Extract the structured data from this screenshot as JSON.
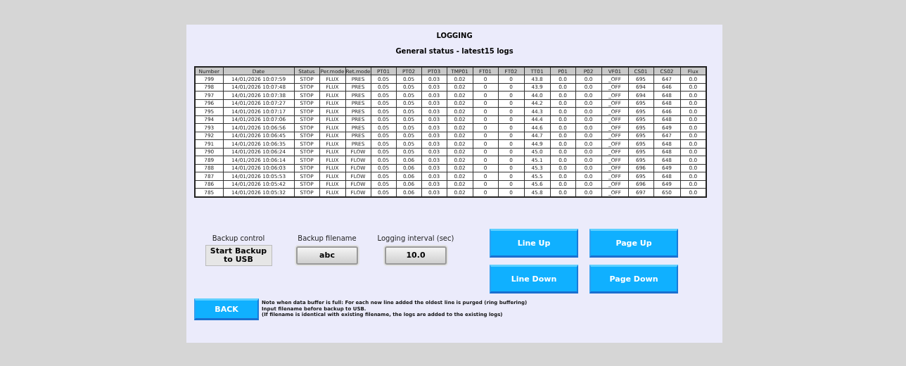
{
  "title": "LOGGING",
  "subtitle": "General status - latest15 logs",
  "table": {
    "columns": [
      "Number",
      "Date",
      "Status",
      "Per.mode",
      "Ret.mode",
      "PT01",
      "PT02",
      "PT03",
      "TMP01",
      "FT01",
      "FT02",
      "TT01",
      "P01",
      "P02",
      "VF01",
      "CS01",
      "CS02",
      "Flux"
    ],
    "rows": [
      [
        "799",
        "14/01/2026 10:07:59",
        "STOP",
        "FLUX",
        "PRES",
        "0.05",
        "0.05",
        "0.03",
        "0.02",
        "0",
        "0",
        "43.8",
        "0.0",
        "0.0",
        "_OFF",
        "695",
        "647",
        "0.0"
      ],
      [
        "798",
        "14/01/2026 10:07:48",
        "STOP",
        "FLUX",
        "PRES",
        "0.05",
        "0.05",
        "0.03",
        "0.02",
        "0",
        "0",
        "43.9",
        "0.0",
        "0.0",
        "_OFF",
        "694",
        "646",
        "0.0"
      ],
      [
        "797",
        "14/01/2026 10:07:38",
        "STOP",
        "FLUX",
        "PRES",
        "0.05",
        "0.05",
        "0.03",
        "0.02",
        "0",
        "0",
        "44.0",
        "0.0",
        "0.0",
        "_OFF",
        "694",
        "648",
        "0.0"
      ],
      [
        "796",
        "14/01/2026 10:07:27",
        "STOP",
        "FLUX",
        "PRES",
        "0.05",
        "0.05",
        "0.03",
        "0.02",
        "0",
        "0",
        "44.2",
        "0.0",
        "0.0",
        "_OFF",
        "695",
        "648",
        "0.0"
      ],
      [
        "795",
        "14/01/2026 10:07:17",
        "STOP",
        "FLUX",
        "PRES",
        "0.05",
        "0.05",
        "0.03",
        "0.02",
        "0",
        "0",
        "44.3",
        "0.0",
        "0.0",
        "_OFF",
        "695",
        "646",
        "0.0"
      ],
      [
        "794",
        "14/01/2026 10:07:06",
        "STOP",
        "FLUX",
        "PRES",
        "0.05",
        "0.05",
        "0.03",
        "0.02",
        "0",
        "0",
        "44.4",
        "0.0",
        "0.0",
        "_OFF",
        "695",
        "648",
        "0.0"
      ],
      [
        "793",
        "14/01/2026 10:06:56",
        "STOP",
        "FLUX",
        "PRES",
        "0.05",
        "0.05",
        "0.03",
        "0.02",
        "0",
        "0",
        "44.6",
        "0.0",
        "0.0",
        "_OFF",
        "695",
        "649",
        "0.0"
      ],
      [
        "792",
        "14/01/2026 10:06:45",
        "STOP",
        "FLUX",
        "PRES",
        "0.05",
        "0.05",
        "0.03",
        "0.02",
        "0",
        "0",
        "44.7",
        "0.0",
        "0.0",
        "_OFF",
        "695",
        "647",
        "0.0"
      ],
      [
        "791",
        "14/01/2026 10:06:35",
        "STOP",
        "FLUX",
        "PRES",
        "0.05",
        "0.05",
        "0.03",
        "0.02",
        "0",
        "0",
        "44.9",
        "0.0",
        "0.0",
        "_OFF",
        "695",
        "648",
        "0.0"
      ],
      [
        "790",
        "14/01/2026 10:06:24",
        "STOP",
        "FLUX",
        "FLOW",
        "0.05",
        "0.05",
        "0.03",
        "0.02",
        "0",
        "0",
        "45.0",
        "0.0",
        "0.0",
        "_OFF",
        "695",
        "648",
        "0.0"
      ],
      [
        "789",
        "14/01/2026 10:06:14",
        "STOP",
        "FLUX",
        "FLOW",
        "0.05",
        "0.06",
        "0.03",
        "0.02",
        "0",
        "0",
        "45.1",
        "0.0",
        "0.0",
        "_OFF",
        "695",
        "648",
        "0.0"
      ],
      [
        "788",
        "14/01/2026 10:06:03",
        "STOP",
        "FLUX",
        "FLOW",
        "0.05",
        "0.06",
        "0.03",
        "0.02",
        "0",
        "0",
        "45.3",
        "0.0",
        "0.0",
        "_OFF",
        "696",
        "649",
        "0.0"
      ],
      [
        "787",
        "14/01/2026 10:05:53",
        "STOP",
        "FLUX",
        "FLOW",
        "0.05",
        "0.06",
        "0.03",
        "0.02",
        "0",
        "0",
        "45.5",
        "0.0",
        "0.0",
        "_OFF",
        "695",
        "648",
        "0.0"
      ],
      [
        "786",
        "14/01/2026 10:05:42",
        "STOP",
        "FLUX",
        "FLOW",
        "0.05",
        "0.06",
        "0.03",
        "0.02",
        "0",
        "0",
        "45.6",
        "0.0",
        "0.0",
        "_OFF",
        "696",
        "649",
        "0.0"
      ],
      [
        "785",
        "14/01/2026 10:05:32",
        "STOP",
        "FLUX",
        "FLOW",
        "0.05",
        "0.06",
        "0.03",
        "0.02",
        "0",
        "0",
        "45.8",
        "0.0",
        "0.0",
        "_OFF",
        "697",
        "650",
        "0.0"
      ]
    ]
  },
  "controls": [
    {
      "label": "Backup control",
      "value": "Start Backup to USB",
      "kind": "button"
    },
    {
      "label": "Backup filename",
      "value": "abc",
      "kind": "field"
    },
    {
      "label": "Logging interval (sec)",
      "value": "10.0",
      "kind": "field"
    }
  ],
  "nav_buttons": [
    "Line Up",
    "Page Up",
    "Line Down",
    "Page Down"
  ],
  "back_button": "BACK",
  "notes": [
    "Note when data buffer is full: For each new line added the oldest line is purged (ring buffering)",
    "Input filename before backup to USB.",
    "(If filename is identical with existing filename, the logs are added to the existing logs)"
  ]
}
